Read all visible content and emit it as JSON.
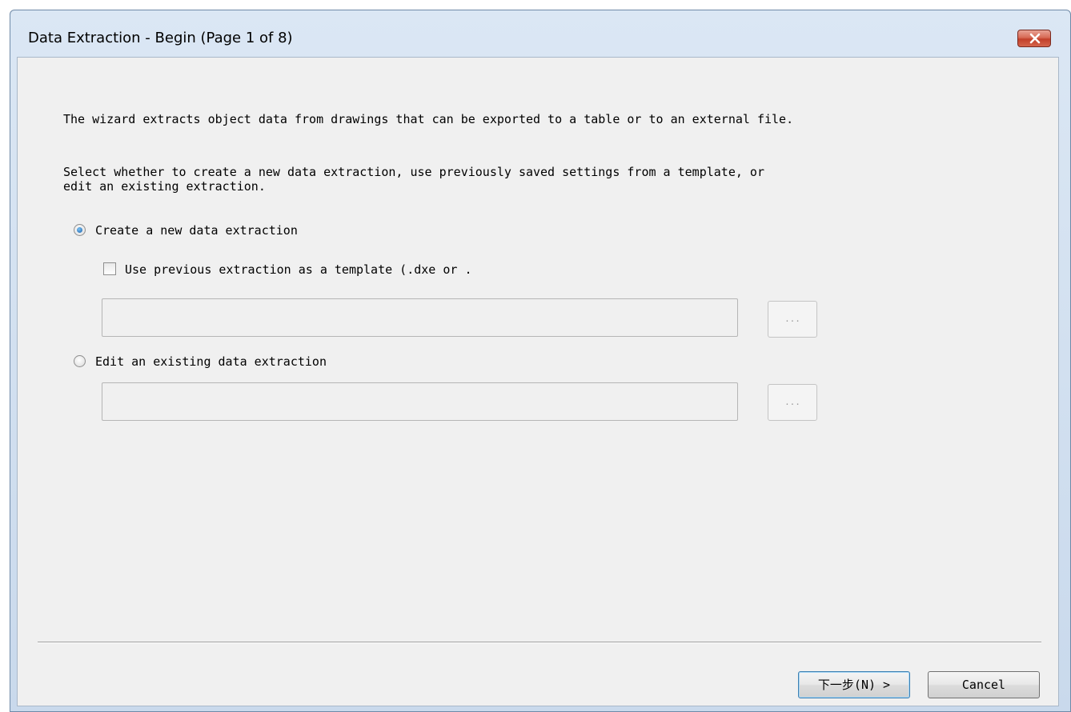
{
  "window": {
    "title": "Data Extraction - Begin (Page 1 of 8)"
  },
  "main": {
    "intro": "The wizard extracts object data from drawings that can be exported to a table or to an external file.",
    "instruction_line1": "Select whether to create a new data extraction, use previously saved settings from a template, or",
    "instruction_line2": "edit an existing extraction.",
    "option_create": {
      "label": "Create a new data extraction",
      "selected": true
    },
    "use_template": {
      "label": "Use previous extraction as a template (.dxe or .",
      "checked": false,
      "value": ""
    },
    "option_edit": {
      "label": "Edit an existing data extraction",
      "selected": false,
      "value": ""
    },
    "browse_label": "..."
  },
  "footer": {
    "next_label": "下一步(N) >",
    "cancel_label": "Cancel"
  }
}
